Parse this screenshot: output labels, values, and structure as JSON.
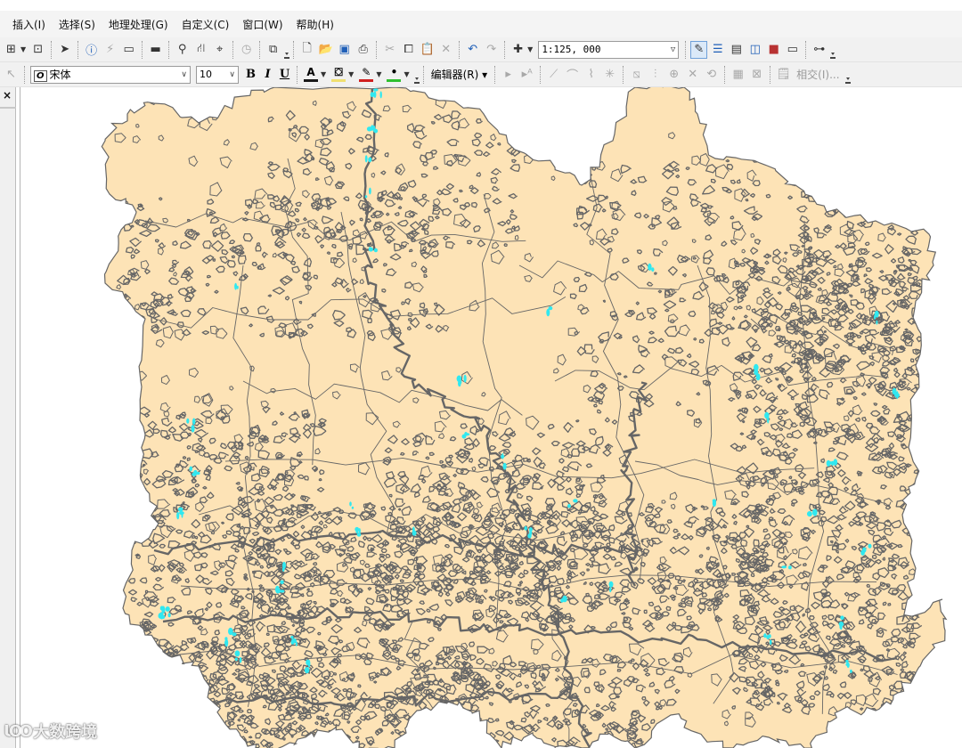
{
  "menubar": {
    "items": [
      "插入(I)",
      "选择(S)",
      "地理处理(G)",
      "自定义(C)",
      "窗口(W)",
      "帮助(H)"
    ]
  },
  "standard_toolbar": {
    "scale": "1:125, 000"
  },
  "drawing_toolbar": {
    "font_name": "宋体",
    "font_size": "10",
    "bold": "B",
    "italic": "I",
    "underline": "U",
    "font_color_glyph": "A",
    "font_color": "#1a1a1a",
    "fill_color": "#f0e070",
    "line_color": "#d02020",
    "marker_color": "#30c030"
  },
  "editor_toolbar": {
    "editor_menu": "编辑器(R)",
    "intersect_label": "相交(I)..."
  },
  "toc_panel": {
    "close_glyph": "×"
  },
  "map": {
    "land_fill": "#fde3b6",
    "boundary_color": "#666666",
    "water_color": "#30e8f0"
  },
  "watermark": {
    "logo": "ƖՕՕ",
    "text": "大数跨境"
  }
}
